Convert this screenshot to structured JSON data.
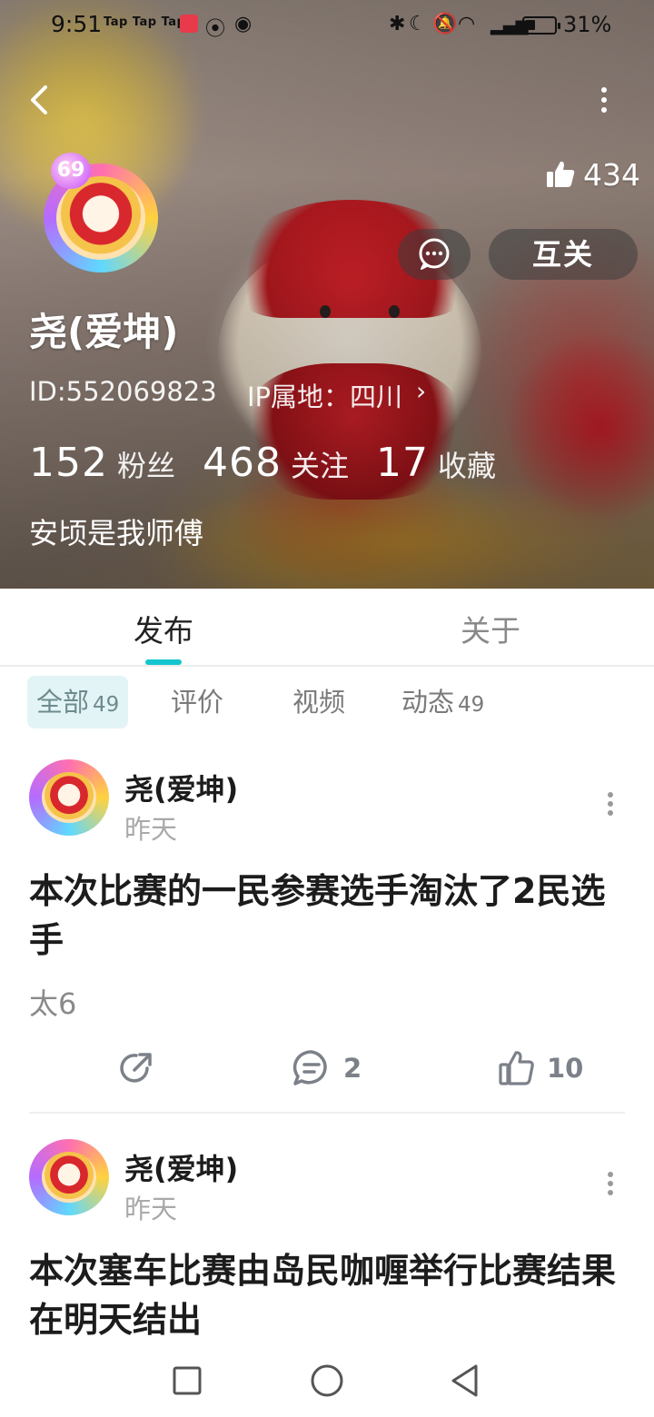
{
  "status_bar": {
    "time": "9:51",
    "app_icons_text": "Tap Tap Tap",
    "battery": "31%"
  },
  "header": {
    "likes": "434",
    "mutual_label": "互关",
    "username": "尧(爱坤)",
    "user_id": "ID:552069823",
    "ip_location": "IP属地：四川",
    "stats": [
      {
        "value": "152",
        "label": "粉丝"
      },
      {
        "value": "468",
        "label": "关注"
      },
      {
        "value": "17",
        "label": "收藏"
      }
    ],
    "bio": "安顷是我师傅",
    "avatar_badge": "69"
  },
  "tabs": {
    "publish": "发布",
    "about": "关于"
  },
  "sub_tabs": [
    {
      "label": "全部",
      "count": "49"
    },
    {
      "label": "评价",
      "count": ""
    },
    {
      "label": "视频",
      "count": ""
    },
    {
      "label": "动态",
      "count": "49"
    }
  ],
  "posts": [
    {
      "author": "尧(爱坤)",
      "time": "昨天",
      "title": "本次比赛的一民参赛选手淘汰了2民选手",
      "body": "太6",
      "comments": "2",
      "likes": "10"
    },
    {
      "author": "尧(爱坤)",
      "time": "昨天",
      "title": "本次塞车比赛由岛民咖喱举行比赛结果在明天结出"
    }
  ],
  "colors": {
    "accent": "#15c5ce",
    "sub_tab_active_bg": "#e3f4f6",
    "muted_text": "#a9a9a9"
  }
}
